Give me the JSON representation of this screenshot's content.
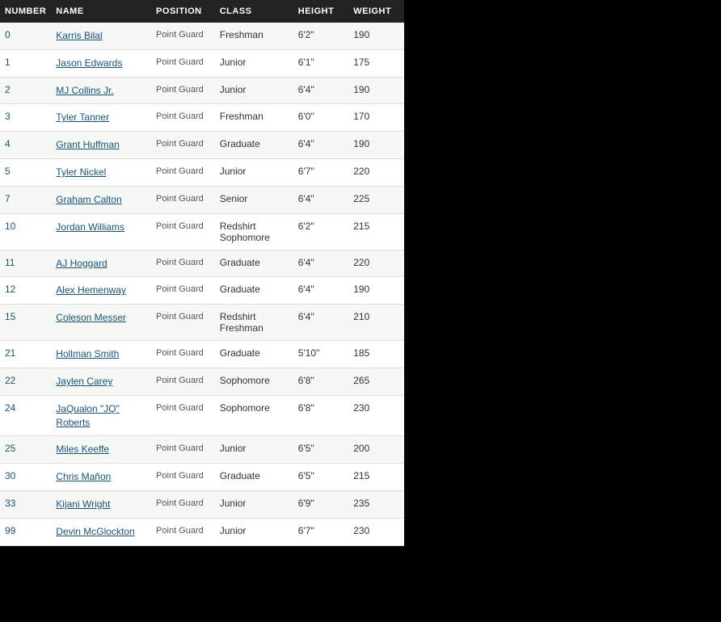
{
  "table": {
    "headers": [
      "NUMBER",
      "NAME",
      "POSITION",
      "CLASS",
      "HEIGHT",
      "WEIGHT"
    ],
    "rows": [
      {
        "number": "0",
        "name": "Karris Bilal",
        "position": "Point Guard",
        "class": "Freshman",
        "height": "6'2\"",
        "weight": "190"
      },
      {
        "number": "1",
        "name": "Jason Edwards",
        "position": "Point Guard",
        "class": "Junior",
        "height": "6'1\"",
        "weight": "175"
      },
      {
        "number": "2",
        "name": "MJ Collins Jr.",
        "position": "Point Guard",
        "class": "Junior",
        "height": "6'4\"",
        "weight": "190"
      },
      {
        "number": "3",
        "name": "Tyler Tanner",
        "position": "Point Guard",
        "class": "Freshman",
        "height": "6'0\"",
        "weight": "170"
      },
      {
        "number": "4",
        "name": "Grant Huffman",
        "position": "Point Guard",
        "class": "Graduate",
        "height": "6'4\"",
        "weight": "190"
      },
      {
        "number": "5",
        "name": "Tyler Nickel",
        "position": "Point Guard",
        "class": "Junior",
        "height": "6'7\"",
        "weight": "220"
      },
      {
        "number": "7",
        "name": "Graham Calton",
        "position": "Point Guard",
        "class": "Senior",
        "height": "6'4\"",
        "weight": "225"
      },
      {
        "number": "10",
        "name": "Jordan Williams",
        "position": "Point Guard",
        "class": "Redshirt Sophomore",
        "height": "6'2\"",
        "weight": "215"
      },
      {
        "number": "11",
        "name": "AJ Hoggard",
        "position": "Point Guard",
        "class": "Graduate",
        "height": "6'4\"",
        "weight": "220"
      },
      {
        "number": "12",
        "name": "Alex Hemenway",
        "position": "Point Guard",
        "class": "Graduate",
        "height": "6'4\"",
        "weight": "190"
      },
      {
        "number": "15",
        "name": "Coleson Messer",
        "position": "Point Guard",
        "class": "Redshirt Freshman",
        "height": "6'4\"",
        "weight": "210"
      },
      {
        "number": "21",
        "name": "Hollman Smith",
        "position": "Point Guard",
        "class": "Graduate",
        "height": "5'10\"",
        "weight": "185"
      },
      {
        "number": "22",
        "name": "Jaylen Carey",
        "position": "Point Guard",
        "class": "Sophomore",
        "height": "6'8\"",
        "weight": "265"
      },
      {
        "number": "24",
        "name": "JaQualon \"JQ\" Roberts",
        "position": "Point Guard",
        "class": "Sophomore",
        "height": "6'8\"",
        "weight": "230"
      },
      {
        "number": "25",
        "name": "Miles Keeffe",
        "position": "Point Guard",
        "class": "Junior",
        "height": "6'5\"",
        "weight": "200"
      },
      {
        "number": "30",
        "name": "Chris Mañon",
        "position": "Point Guard",
        "class": "Graduate",
        "height": "6'5\"",
        "weight": "215"
      },
      {
        "number": "33",
        "name": "Kijani Wright",
        "position": "Point Guard",
        "class": "Junior",
        "height": "6'9\"",
        "weight": "235"
      },
      {
        "number": "99",
        "name": "Devin McGlockton",
        "position": "Point Guard",
        "class": "Junior",
        "height": "6'7\"",
        "weight": "230"
      }
    ]
  }
}
